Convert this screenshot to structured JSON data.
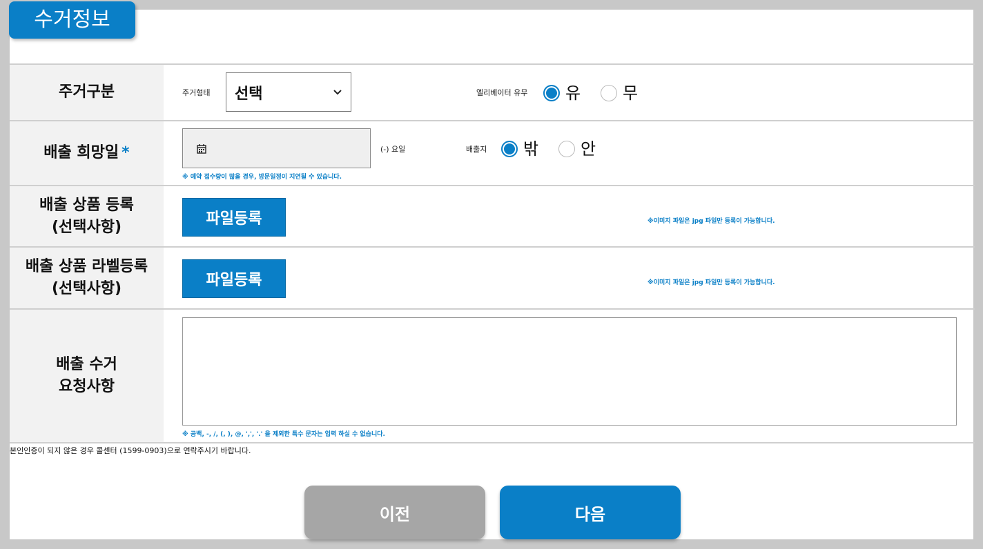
{
  "header": {
    "title": "수거정보"
  },
  "rows": {
    "housing": {
      "label": "주거구분",
      "type_label": "주거형태",
      "type_value": "선택",
      "elevator_label": "엘리베이터 유무",
      "elevator_yes": "유",
      "elevator_no": "무",
      "elevator_selected": "유"
    },
    "date": {
      "label": "배출 희망일",
      "required_mark": "*",
      "weekday_text": "(-) 요일",
      "place_label": "배출지",
      "place_outside": "밖",
      "place_inside": "안",
      "place_selected": "밖",
      "note": "※ 예약 접수량이 많을 경우, 방문일정이 지연될 수 있습니다."
    },
    "product": {
      "label_line1": "배출 상품 등록",
      "label_line2": "(선택사항)",
      "button": "파일등록",
      "note": "※이미지 파일은 jpg 파일만 등록이 가능합니다."
    },
    "label_reg": {
      "label_line1": "배출 상품 라벨등록",
      "label_line2": "(선택사항)",
      "button": "파일등록",
      "note": "※이미지 파일은 jpg 파일만 등록이 가능합니다."
    },
    "request": {
      "label_line1": "배출 수거",
      "label_line2": "요청사항",
      "textarea_value": "",
      "note": "※ 공백, -, /, (, ), @, ',', '.' 을 제외한 특수 문자는 입력 하실 수 없습니다."
    }
  },
  "footer": {
    "notice": "본인인증이 되지 않은 경우 콜센터 (1599-0903)으로 연락주시기 바랍니다.",
    "prev_button": "이전",
    "next_button": "다음"
  },
  "colors": {
    "accent": "#0a7fc7",
    "label_bg": "#f2f2f2",
    "disabled": "#a6a6a6"
  },
  "icons": {
    "select": "chevron-down-icon",
    "date": "calendar-icon"
  }
}
